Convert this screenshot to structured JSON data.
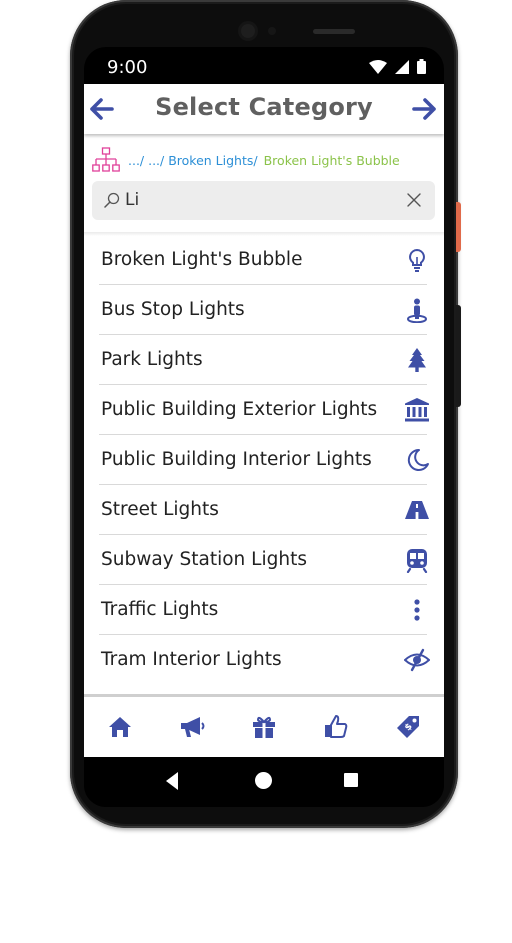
{
  "status_bar": {
    "time": "9:00"
  },
  "header": {
    "title": "Select Category",
    "back_icon": "arrow-left-icon",
    "forward_icon": "arrow-right-icon"
  },
  "breadcrumb": {
    "icon": "hierarchy-icon",
    "path": ".../ .../ Broken Lights/",
    "current": "Broken Light's Bubble"
  },
  "search": {
    "value": "Li",
    "placeholder": ""
  },
  "items": [
    {
      "label": "Broken Light's Bubble",
      "icon": "lightbulb-icon"
    },
    {
      "label": "Bus Stop Lights",
      "icon": "person-standing-icon"
    },
    {
      "label": "Park Lights",
      "icon": "tree-icon"
    },
    {
      "label": "Public Building Exterior Lights",
      "icon": "government-building-icon"
    },
    {
      "label": "Public Building Interior Lights",
      "icon": "moon-icon"
    },
    {
      "label": "Street Lights",
      "icon": "road-icon"
    },
    {
      "label": "Subway Station Lights",
      "icon": "subway-icon"
    },
    {
      "label": "Traffic Lights",
      "icon": "traffic-light-icon"
    },
    {
      "label": "Tram Interior Lights",
      "icon": "eye-slash-icon"
    }
  ],
  "tabbar": [
    "home-icon",
    "megaphone-icon",
    "gift-icon",
    "thumbs-up-icon",
    "tag-icon"
  ],
  "colors": {
    "accent": "#3f4fa6",
    "breadcrumb": "#2c8fd6",
    "breadcrumb_current": "#8bc34a",
    "hierarchy": "#e0419a"
  }
}
